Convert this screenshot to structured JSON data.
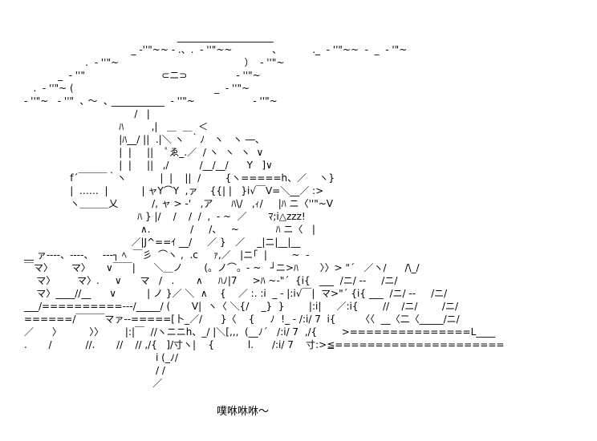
{
  "art": {
    "lines": [
      "                                                  ____________________     ",
      "                                   _ ‐''\"~~ ‐ .、.  ‐ ''\"~~             、          ._  ‐ ''\"~~  ‐  _  ‐ '\"~",
      "                    .  ‐ ''\"~                                         ）  ‐ ''\"~",
      "           _  ‐ ''\"                         ⊂ニ⊃                ‐ ''\"~",
      "   .  ‐ ''\"~ (                                              _  ‐ ''\"~",
      "‐ ''\"~   ‐ ''\"  ､ ～  ､ ___________  ‐ ''\"~                   ‐ ''\"~",
      "                                    /   |",
      "                               ﾊ         ,|   ＿  ＿  ＜",
      "                               |ﾊ__/ ||  .|＼ ヽ  ｀ﾉ   ヽ   ヽ ―、",
      "                               |  |     ||    ﾟゑ_.／  / ヽ  ヽ  ヽ  ∨",
      "                               |  |     ||   ,/          /__/__/      Y   ]∨",
      "               f´￣￣￣｀ヽ           |  |    ||  /        {ヽ=====h、／    ヽ}",
      "               |  ……  |           | ャY⌒Y  ,ァ    {{| |   }i√￣V=＼__／ :>",
      "               ヽ＿＿＿乂           /, ャ > ‐'   ,ア      ﾊ\\/   ,ｨ/     |ﾊ ニ〈''\"~V",
      "                                     ﾊ } |/    /    /  /  ,  ‐ ~  ／       ﾏ;i△zzz!",
      "                                      ∧.             /     /、   ~            ﾊ ニ〈   |",
      "                                   ／|J^==ｲ __/     ／ }   ／    _|ニ|__|__",
      "__ ァ‐‐‐‐、‐‐‐‐、   ‐‐‐┐ ﾍ  ￣彡  ⌒ヽ ,  .c     ｧ,／   |ニ｢  |        ~  -",
      "￣マ〉      マ〉     ∨￣￣|      ＼＿ノ       (。ノ⌒。- ~   ┘ニ>ﾊ       〉〉> \"´   ／ヽ/      /\\_/",
      "    マ〉       マ〉.     ∨      マ   /   .       ∧     ﾊﾉ|7     >ﾊ ~‐\"´  {i{   ___  /ニ/ ‐‐     /ニ/",
      "    マ〉____//__      ∨          | ノ }／ ＼  ∧    {    ／ :. :i  _ ‐ |:i√￣|  マ>\"´ {i{ ___  /ニ/ ‐‐     /ニ/",
      "___/==========‐‐‐/_____/ (       V|  ヽ〈 ＼{/    _}  }        |:i|     ／:i{        //    /ニ/        /ニ/",
      "======/￣￣￣マァ‐‐=====[卜_／/      }〈    {     ﾉ  !_ ‐ /:i/ 7  i{        〈〈  __〈二〈_____/ニ/",
      "／      〉         〉〉       |:|￣  //ヽニニh、_/ |＼[,,,  (__ﾉ´   /:i/ 7  ,/{        >===============L____",
      ".       /           //.       //    // ,/{   ]/寸ヽ|    {           l.      /:i/ 7    寸:>≦=====================",
      "                                           i (_ﾉ/",
      "                                           / /",
      "                                          ／"
    ],
    "caption": "噗咻咻咻～"
  }
}
